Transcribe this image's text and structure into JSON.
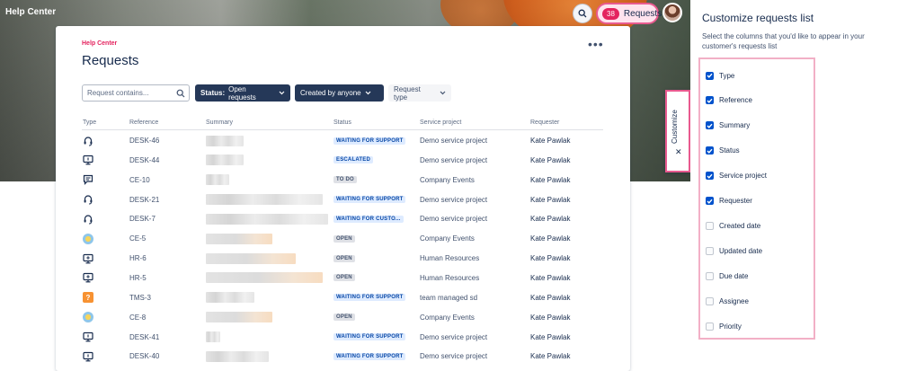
{
  "header": {
    "site_title": "Help Center",
    "requests_count": "38",
    "requests_label": "Requests"
  },
  "page": {
    "breadcrumb": "Help Center",
    "title": "Requests"
  },
  "filters": {
    "search_placeholder": "Request contains...",
    "status_key": "Status:",
    "status_value": "Open requests",
    "created_by": "Created by anyone",
    "request_type": "Request type"
  },
  "table": {
    "columns": [
      "Type",
      "Reference",
      "Summary",
      "Status",
      "Service project",
      "Requester"
    ],
    "rows": [
      {
        "type_icon": "headset-icon",
        "reference": "DESK-46",
        "status": "WAITING FOR SUPPORT",
        "status_color": "blue",
        "project": "Demo service project",
        "requester": "Kate Pawlak",
        "blur_w": 42
      },
      {
        "type_icon": "monitor-icon",
        "reference": "DESK-44",
        "status": "ESCALATED",
        "status_color": "blue",
        "project": "Demo service project",
        "requester": "Kate Pawlak",
        "blur_w": 42
      },
      {
        "type_icon": "message-icon",
        "reference": "CE-10",
        "status": "TO DO",
        "status_color": "grey",
        "project": "Company Events",
        "requester": "Kate Pawlak",
        "blur_w": 26
      },
      {
        "type_icon": "headset-icon",
        "reference": "DESK-21",
        "status": "WAITING FOR SUPPORT",
        "status_color": "blue",
        "project": "Demo service project",
        "requester": "Kate Pawlak",
        "blur_w": 130
      },
      {
        "type_icon": "headset-icon",
        "reference": "DESK-7",
        "status": "WAITING FOR CUSTO...",
        "status_color": "blue",
        "project": "Demo service project",
        "requester": "Kate Pawlak",
        "blur_w": 136
      },
      {
        "type_icon": "sun-icon",
        "reference": "CE-5",
        "status": "OPEN",
        "status_color": "grey",
        "project": "Company Events",
        "requester": "Kate Pawlak",
        "blur_w": 74
      },
      {
        "type_icon": "monitor-plus-icon",
        "reference": "HR-6",
        "status": "OPEN",
        "status_color": "grey",
        "project": "Human Resources",
        "requester": "Kate Pawlak",
        "blur_w": 100
      },
      {
        "type_icon": "monitor-plus-icon",
        "reference": "HR-5",
        "status": "OPEN",
        "status_color": "grey",
        "project": "Human Resources",
        "requester": "Kate Pawlak",
        "blur_w": 130
      },
      {
        "type_icon": "question-icon",
        "reference": "TMS-3",
        "status": "WAITING FOR SUPPORT",
        "status_color": "blue",
        "project": "team managed sd",
        "requester": "Kate Pawlak",
        "blur_w": 54
      },
      {
        "type_icon": "sun-icon",
        "reference": "CE-8",
        "status": "OPEN",
        "status_color": "grey",
        "project": "Company Events",
        "requester": "Kate Pawlak",
        "blur_w": 74
      },
      {
        "type_icon": "monitor-icon",
        "reference": "DESK-41",
        "status": "WAITING FOR SUPPORT",
        "status_color": "blue",
        "project": "Demo service project",
        "requester": "Kate Pawlak",
        "blur_w": 16
      },
      {
        "type_icon": "monitor-icon",
        "reference": "DESK-40",
        "status": "WAITING FOR SUPPORT",
        "status_color": "blue",
        "project": "Demo service project",
        "requester": "Kate Pawlak",
        "blur_w": 70
      }
    ]
  },
  "customize_tab": {
    "label": "Customize"
  },
  "panel": {
    "title": "Customize requests list",
    "description": "Select the columns that you'd like to appear in your customer's requests list",
    "options": [
      {
        "label": "Type",
        "checked": true
      },
      {
        "label": "Reference",
        "checked": true
      },
      {
        "label": "Summary",
        "checked": true
      },
      {
        "label": "Status",
        "checked": true
      },
      {
        "label": "Service project",
        "checked": true
      },
      {
        "label": "Requester",
        "checked": true
      },
      {
        "label": "Created date",
        "checked": false
      },
      {
        "label": "Updated date",
        "checked": false
      },
      {
        "label": "Due date",
        "checked": false
      },
      {
        "label": "Assignee",
        "checked": false
      },
      {
        "label": "Priority",
        "checked": false
      }
    ]
  },
  "colors": {
    "accent_pink": "#e4245f",
    "navy": "#253858",
    "link_blue": "#0052cc"
  }
}
